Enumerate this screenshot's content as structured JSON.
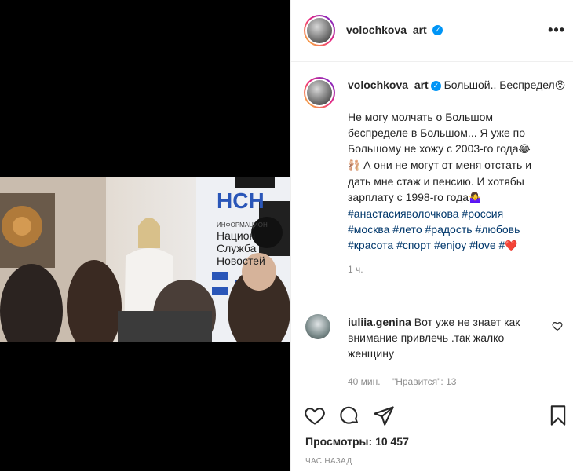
{
  "post": {
    "username": "volochkova_art",
    "caption_title": "Большой.. Беспредел",
    "caption_lines": [
      "Не могу молчать о Большом",
      "беспределе в Большом... Я уже по",
      "Большому не хожу с 2003-го года",
      "А они не могут от меня отстать и",
      "дать мне стаж и пенсию. И хотябы",
      "зарплату с 1998-го года"
    ],
    "hashtags": [
      "#анастасияволочкова",
      "#россия",
      "#москва",
      "#лето",
      "#радость",
      "#любовь",
      "#красота",
      "#спорт",
      "#enjoy",
      "#love",
      "#"
    ],
    "time": "1 ч."
  },
  "comment": {
    "username": "iuliia.genina",
    "text": "Вот уже не знает как внимание привлечь .так жалко женщину",
    "time": "40 мин.",
    "likes": "\"Нравится\": 13"
  },
  "stats": {
    "views_label": "Просмотры:",
    "views_count": "10 457",
    "posted_ago": "ЧАС НАЗАД"
  },
  "photo_sign": {
    "logo": "НСН",
    "line0": "ИНФОРМАЦИОН",
    "line1": "Национ",
    "line2": "Служба",
    "line3": "Новостей"
  },
  "icons": {
    "more": "more-options-icon",
    "like": "heart-icon",
    "comment": "comment-icon",
    "share": "share-icon",
    "save": "bookmark-icon",
    "verified": "verified-badge-icon"
  },
  "colors": {
    "verified": "#0095f6",
    "hashtag": "#00376b",
    "muted": "#8e8e8e"
  }
}
